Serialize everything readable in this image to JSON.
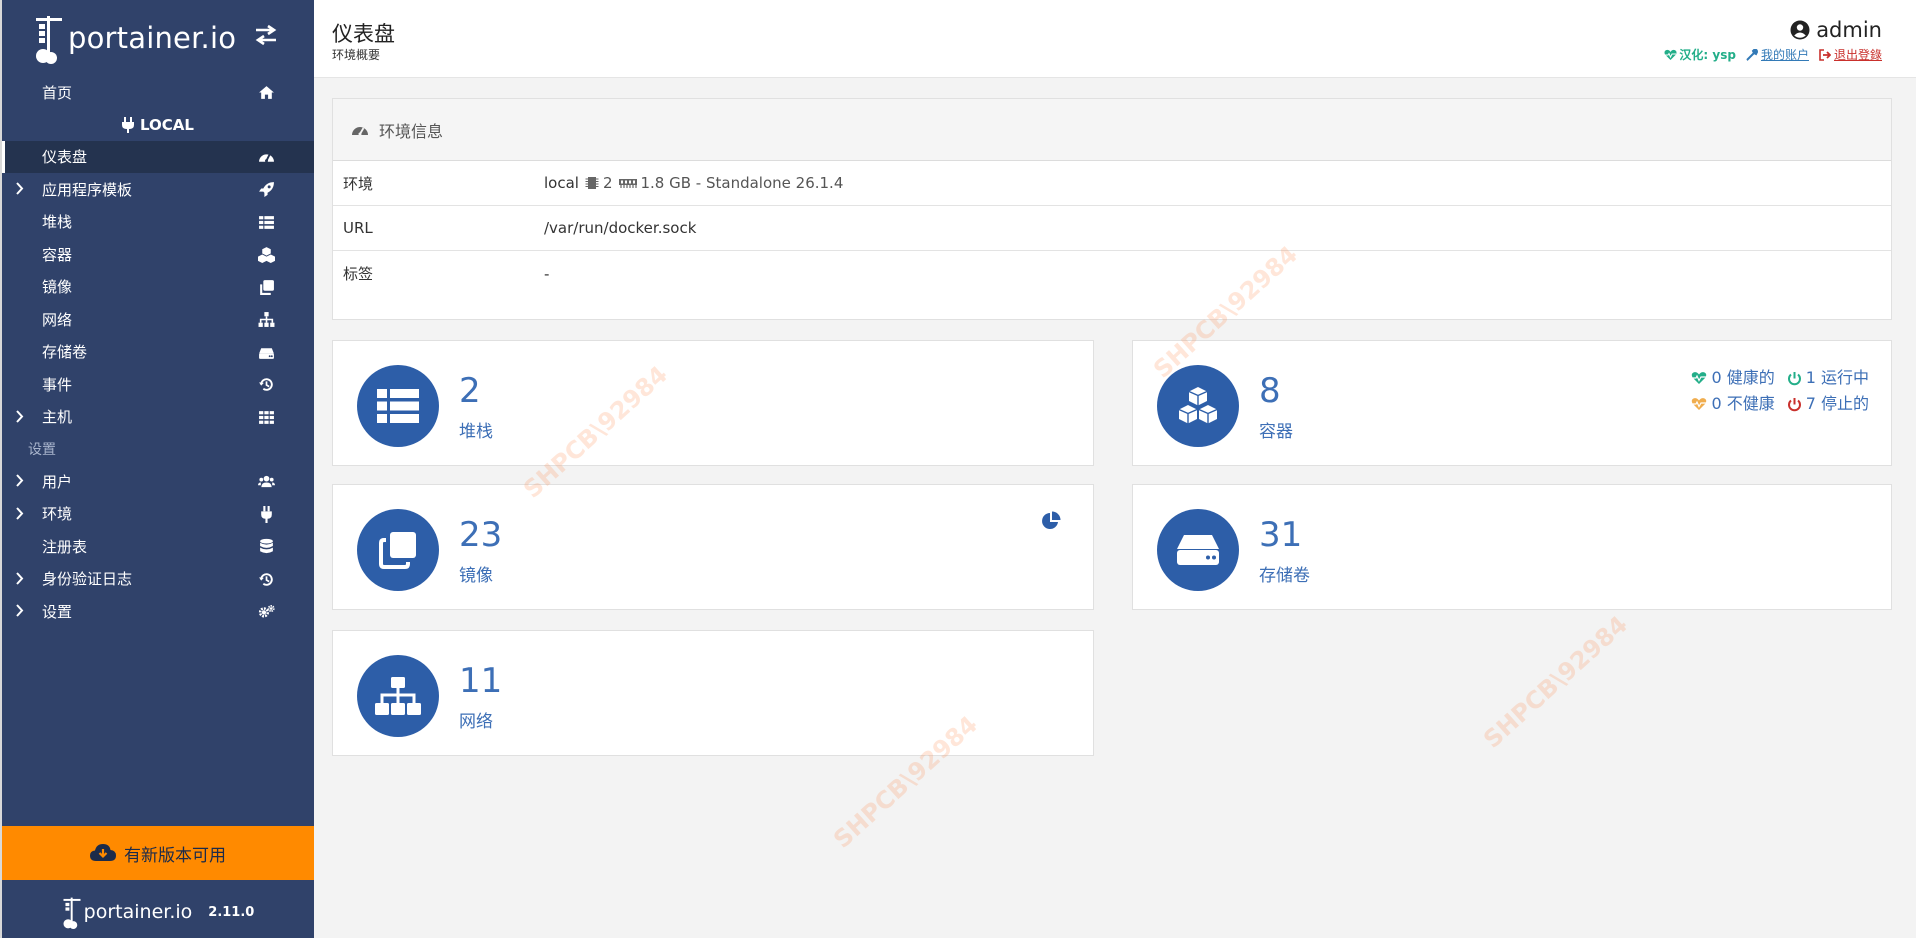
{
  "sidebar": {
    "brand": "portainer.io",
    "nav": {
      "home": "首页",
      "environment": "LOCAL",
      "dashboard": "仪表盘",
      "app_templates": "应用程序模板",
      "stacks": "堆栈",
      "containers": "容器",
      "images": "镜像",
      "networks": "网络",
      "volumes": "存储卷",
      "events": "事件",
      "host": "主机",
      "settings_section": "设置",
      "users": "用户",
      "environments": "环境",
      "registries": "注册表",
      "auth_logs": "身份验证日志",
      "settings": "设置"
    },
    "update_banner": "有新版本可用",
    "footer": {
      "brand": "portainer.io",
      "version": "2.11.0"
    }
  },
  "header": {
    "title": "仪表盘",
    "subtitle": "环境概要",
    "username": "admin",
    "credit": "汉化: ysp",
    "my_account": "我的账户",
    "logout": "退出登錄"
  },
  "env_info": {
    "title": "环境信息",
    "rows": {
      "environment": {
        "key": "环境",
        "name": "local",
        "cpu": "2",
        "memory": "1.8 GB - Standalone 26.1.4"
      },
      "url": {
        "key": "URL",
        "value": "/var/run/docker.sock"
      },
      "tags": {
        "key": "标签",
        "value": "-"
      }
    }
  },
  "cards": {
    "stacks": {
      "count": "2",
      "label": "堆栈"
    },
    "containers": {
      "count": "8",
      "label": "容器",
      "healthy": "0 健康的",
      "running": "1 运行中",
      "unhealthy": "0 不健康",
      "stopped": "7 停止的"
    },
    "images": {
      "count": "23",
      "label": "镜像"
    },
    "volumes": {
      "count": "31",
      "label": "存储卷"
    },
    "networks": {
      "count": "11",
      "label": "网络"
    }
  },
  "watermark": "SHPCB\\92984",
  "colors": {
    "sidebar": "#30426a",
    "accent": "#2d5ea8",
    "update": "#ff8a00",
    "healthy": "#23ae89",
    "unhealthy": "#f0ad4e",
    "stopped": "#c9302c"
  }
}
